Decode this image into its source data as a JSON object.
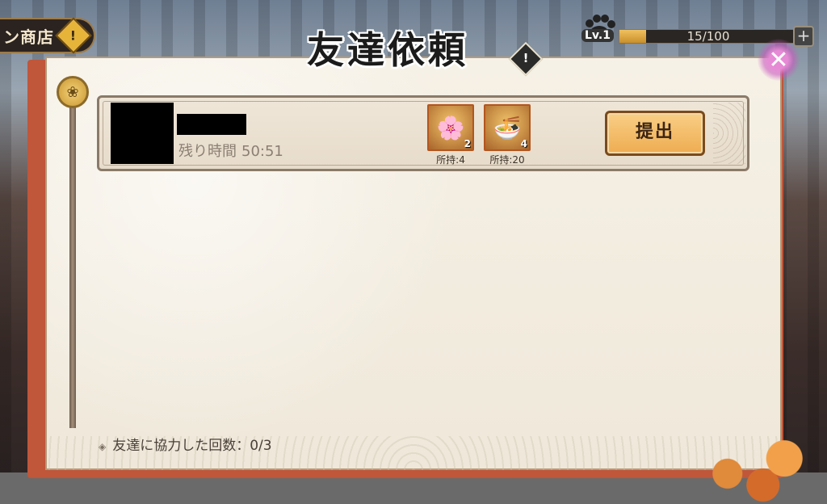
{
  "background": {
    "shop_tab_label": "ン商店",
    "shop_alert": "!"
  },
  "level": {
    "lv_label": "Lv.1",
    "progress_text": "15/100",
    "progress_fraction": 0.15,
    "plus_label": "+"
  },
  "dialog": {
    "title": "友達依頼",
    "help_label": "!",
    "close_icon": "crossed-swords-icon",
    "requests": [
      {
        "timer_label": "残り時間",
        "timer_value": "50:51",
        "items": [
          {
            "icon": "sakura-bonsai-icon",
            "quantity": "2",
            "owned": "所持:4"
          },
          {
            "icon": "ramen-bowl-icon",
            "quantity": "4",
            "owned": "所持:20"
          }
        ],
        "submit_label": "提出"
      }
    ],
    "coop_label": "友達に協力した回数：0/3"
  },
  "colors": {
    "accent_orange": "#eeac51",
    "panel_bg": "#f4efe4",
    "panel_border": "#c0563a"
  }
}
